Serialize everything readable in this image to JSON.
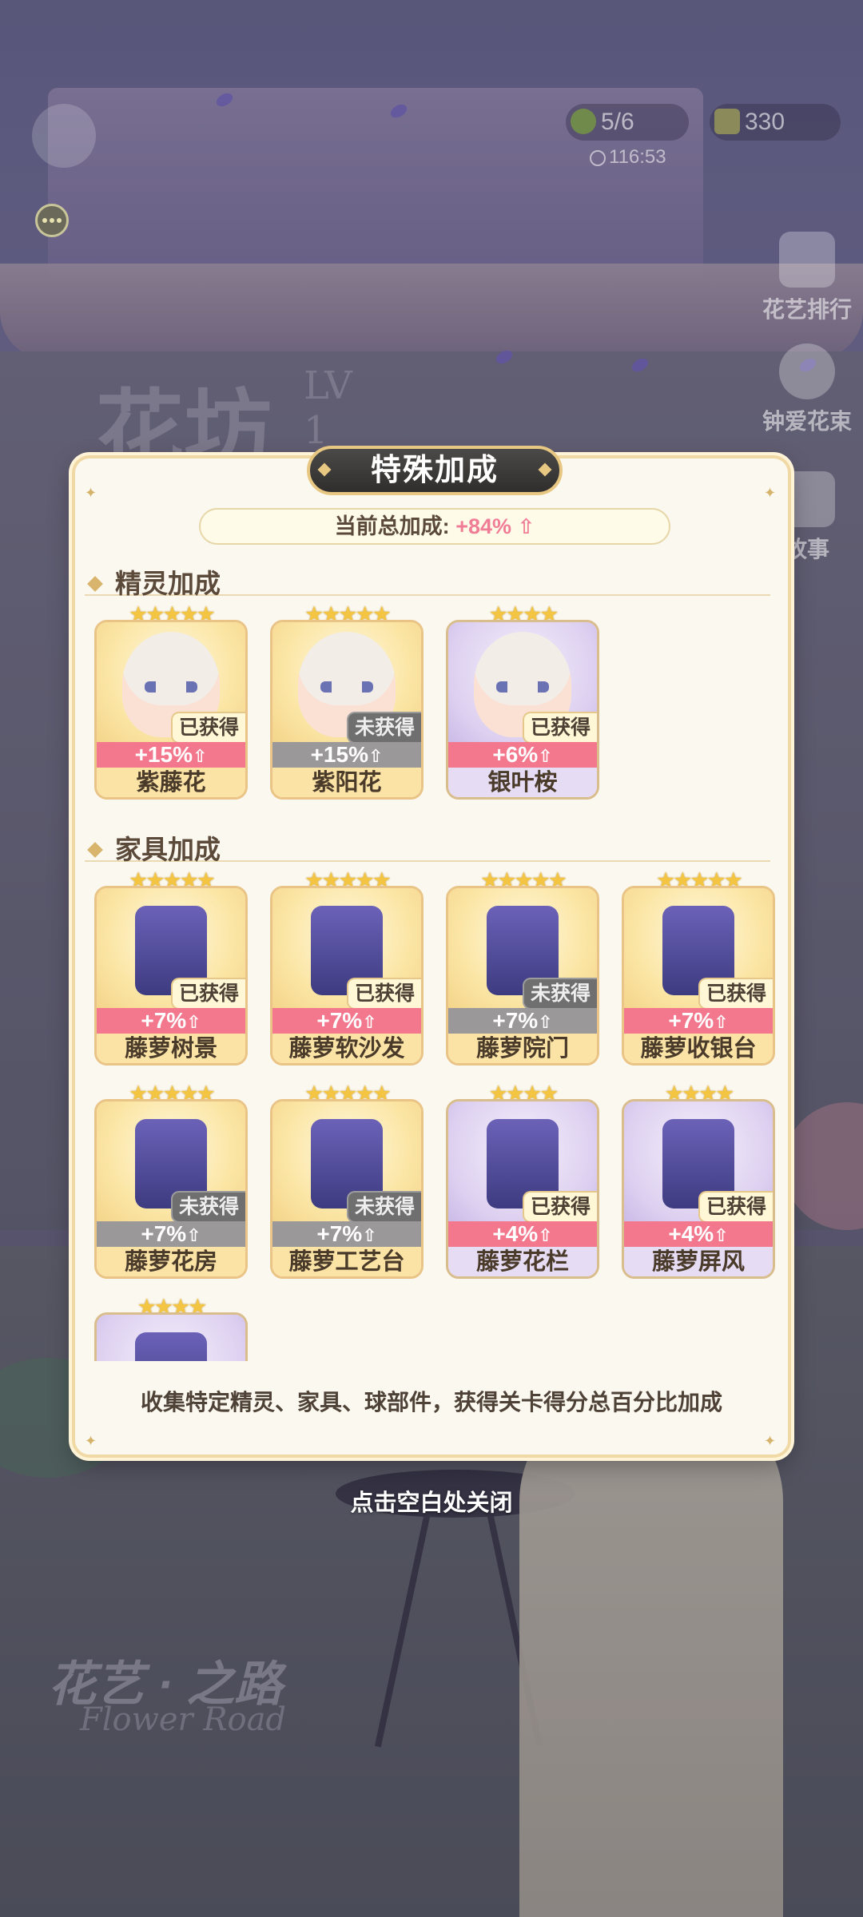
{
  "background": {
    "shop_title": "花坊",
    "level_label": "LV",
    "level_value": "1",
    "logo_text": "花艺 · 之路",
    "logo_sub": "Flower Road"
  },
  "hud": {
    "energy": "5/6",
    "currency": "330",
    "timer": "116:53",
    "side_buttons": [
      {
        "label": "花艺排行",
        "icon": "ranking-icon"
      },
      {
        "label": "钟爱花束",
        "icon": "bouquet-icon"
      },
      {
        "label": "故事",
        "icon": "story-icon"
      }
    ]
  },
  "modal": {
    "title": "特殊加成",
    "total_label": "当前总加成:",
    "total_value": "+84%",
    "sections": {
      "spirits": "精灵加成",
      "furniture": "家具加成"
    },
    "spirits": [
      {
        "stars": "★★★★★",
        "status": "已获得",
        "owned": true,
        "bonus": "+15%",
        "name": "紫藤花",
        "bg": "gold"
      },
      {
        "stars": "★★★★★",
        "status": "未获得",
        "owned": false,
        "bonus": "+15%",
        "name": "紫阳花",
        "bg": "gold"
      },
      {
        "stars": "★★★★",
        "status": "已获得",
        "owned": true,
        "bonus": "+6%",
        "name": "银叶桉",
        "bg": "purple"
      }
    ],
    "furniture": [
      {
        "stars": "★★★★★",
        "status": "已获得",
        "owned": true,
        "bonus": "+7%",
        "name": "藤萝树景",
        "bg": "gold"
      },
      {
        "stars": "★★★★★",
        "status": "已获得",
        "owned": true,
        "bonus": "+7%",
        "name": "藤萝软沙发",
        "bg": "gold"
      },
      {
        "stars": "★★★★★",
        "status": "未获得",
        "owned": false,
        "bonus": "+7%",
        "name": "藤萝院门",
        "bg": "gold"
      },
      {
        "stars": "★★★★★",
        "status": "已获得",
        "owned": true,
        "bonus": "+7%",
        "name": "藤萝收银台",
        "bg": "gold"
      },
      {
        "stars": "★★★★★",
        "status": "未获得",
        "owned": false,
        "bonus": "+7%",
        "name": "藤萝花房",
        "bg": "gold"
      },
      {
        "stars": "★★★★★",
        "status": "未获得",
        "owned": false,
        "bonus": "+7%",
        "name": "藤萝工艺台",
        "bg": "gold"
      },
      {
        "stars": "★★★★",
        "status": "已获得",
        "owned": true,
        "bonus": "+4%",
        "name": "藤萝花栏",
        "bg": "purple"
      },
      {
        "stars": "★★★★",
        "status": "已获得",
        "owned": true,
        "bonus": "+4%",
        "name": "藤萝屏风",
        "bg": "purple"
      },
      {
        "stars": "★★★★",
        "status": "",
        "owned": null,
        "bonus": "",
        "name": "",
        "bg": "purple"
      }
    ],
    "footer": "收集特定精灵、家具、球部件，获得关卡得分总百分比加成"
  },
  "close_hint": "点击空白处关闭",
  "colors": {
    "bonus_pink": "#f3788d",
    "bonus_gray": "#9a9898",
    "card_gold": "#fbe3a6",
    "card_purple": "#e6dcf4",
    "accent_gold": "#e8c783"
  }
}
